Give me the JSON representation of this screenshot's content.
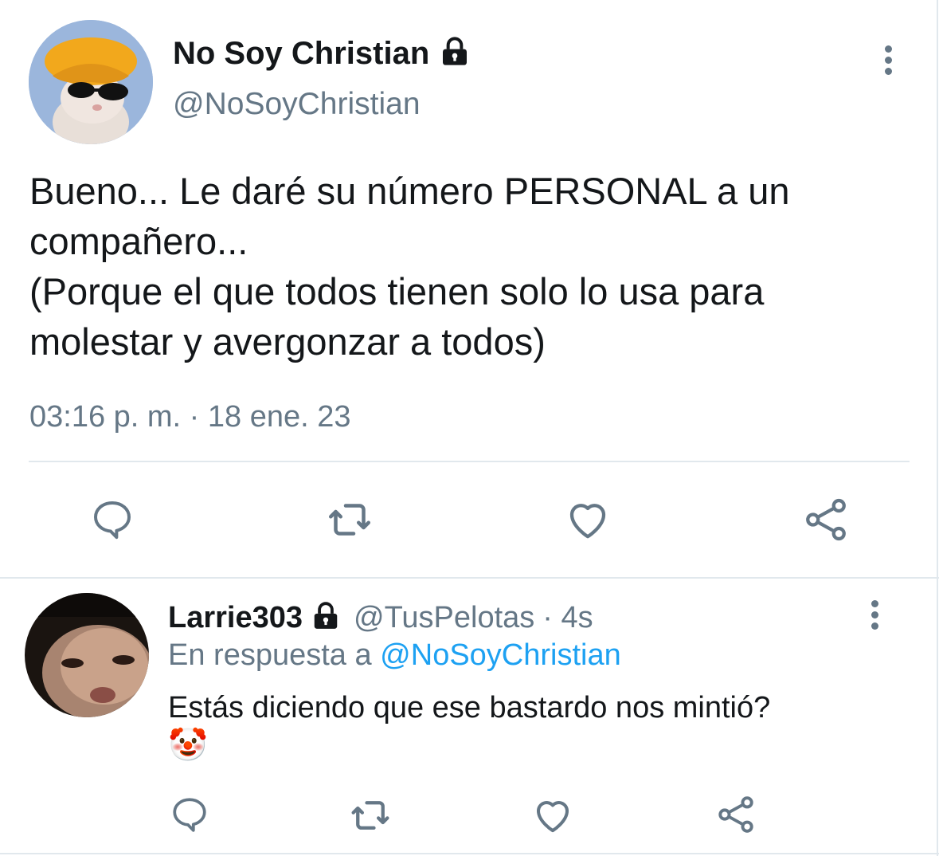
{
  "main_tweet": {
    "display_name": "No Soy Christian",
    "handle": "@NoSoyChristian",
    "text_lines": [
      "Bueno... Le daré su número PERSONAL a un",
      "compañero...",
      "(Porque el que todos tienen solo lo usa para",
      "molestar y avergonzar a todos)"
    ],
    "timestamp": "03:16 p. m. · 18 ene. 23"
  },
  "reply": {
    "display_name": "Larrie303",
    "handle": "@TusPelotas",
    "age": "· 4s",
    "in_reply_prefix": "En respuesta a",
    "in_reply_to": "@NoSoyChristian",
    "text": "Estás diciendo que ese bastardo nos mintió?",
    "emoji": "🤡"
  },
  "icons": {
    "lock": "lock-icon",
    "more": "more-options-icon",
    "reply": "reply-icon",
    "retweet": "retweet-icon",
    "like": "heart-icon",
    "share": "share-icon"
  },
  "colors": {
    "text": "#14171a",
    "muted": "#657786",
    "link": "#1da1f2",
    "divider": "#e1e8ed"
  }
}
